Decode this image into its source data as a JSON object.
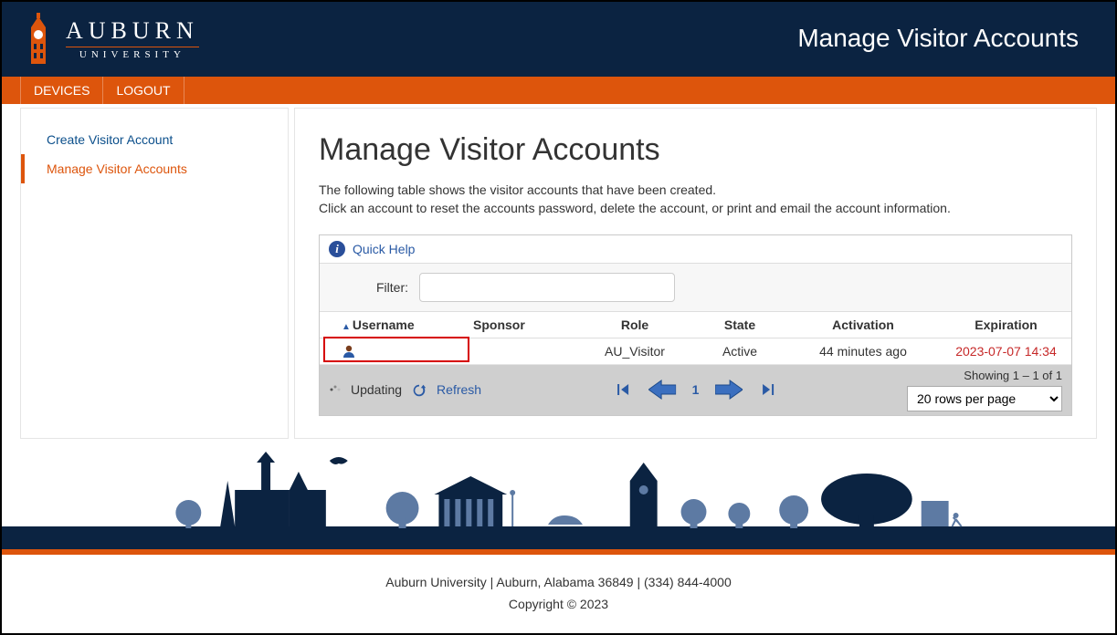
{
  "header": {
    "brand_big": "AUBURN",
    "brand_small": "UNIVERSITY",
    "page_title": "Manage Visitor Accounts"
  },
  "nav": {
    "devices": "DEVICES",
    "logout": "LOGOUT"
  },
  "sidebar": {
    "items": [
      {
        "label": "Create Visitor Account"
      },
      {
        "label": "Manage Visitor Accounts"
      }
    ]
  },
  "main": {
    "heading": "Manage Visitor Accounts",
    "intro_l1": "The following table shows the visitor accounts that have been created.",
    "intro_l2": "Click an account to reset the accounts password, delete the account, or print and email the account information.",
    "quick_help": "Quick Help",
    "filter_label": "Filter:",
    "columns": {
      "username": "Username",
      "sponsor": "Sponsor",
      "role": "Role",
      "state": "State",
      "activation": "Activation",
      "expiration": "Expiration"
    },
    "row": {
      "role": "AU_Visitor",
      "state": "Active",
      "activation": "44 minutes ago",
      "expiration": "2023-07-07 14:34"
    },
    "pager": {
      "updating": "Updating",
      "refresh": "Refresh",
      "page": "1",
      "showing": "Showing 1 – 1 of 1",
      "rows_select": "20 rows per page"
    }
  },
  "footer": {
    "line1": "Auburn University | Auburn, Alabama 36849 | (334) 844-4000",
    "line2": "Copyright © 2023"
  }
}
